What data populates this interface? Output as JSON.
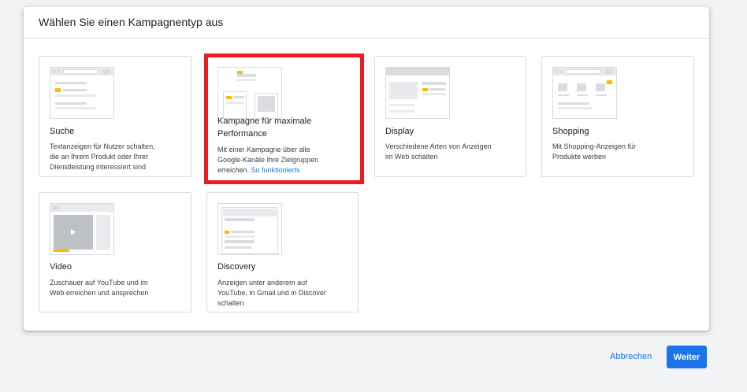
{
  "dialog": {
    "title": "Wählen Sie einen Kampagnentyp aus"
  },
  "cards": {
    "search": {
      "title": "Suche",
      "desc_lines": [
        "Textanzeigen für Nutzer schalten,",
        "die an Ihrem Produkt oder Ihrer",
        "Dienstleistung interessiert sind"
      ]
    },
    "pmax": {
      "title_lines": [
        "Kampagne für maximale",
        "Performance"
      ],
      "desc_lines": [
        "Mit einer Kampagne über alle",
        "Google-Kanäle Ihre Zielgruppen"
      ],
      "desc_last": "erreichen.",
      "link": "So funktionierts"
    },
    "display": {
      "title": "Display",
      "desc_lines": [
        "Verschiedene Arten von Anzeigen",
        "im Web schalten"
      ]
    },
    "shopping": {
      "title": "Shopping",
      "desc_lines": [
        "Mit Shopping-Anzeigen für",
        "Produkte werben"
      ]
    },
    "video": {
      "title": "Video",
      "desc_lines": [
        "Zuschauer auf YouTube und im",
        "Web erreichen und ansprechen"
      ]
    },
    "discovery": {
      "title": "Discovery",
      "desc_lines": [
        "Anzeigen unter anderem auf",
        "YouTube, in Gmail und in Discover",
        "schalten"
      ]
    }
  },
  "footer": {
    "cancel_label": "Abbrechen",
    "next_label": "Weiter"
  },
  "colors": {
    "accent": "#1a73e8",
    "highlight": "#ea1c24",
    "ad_marker": "#fbbc04"
  }
}
